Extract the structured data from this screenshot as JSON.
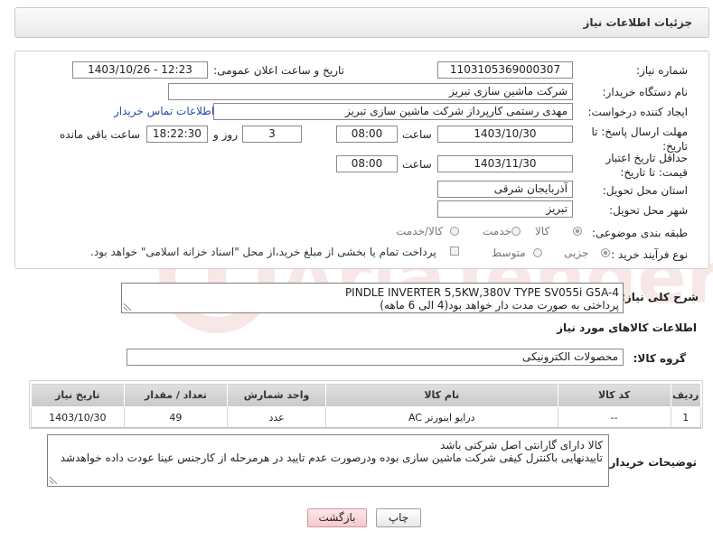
{
  "header": {
    "title": "جزئیات اطلاعات نیاز"
  },
  "form": {
    "need_number": {
      "label": "شماره نیاز:",
      "value": "1103105369000307"
    },
    "announce_datetime": {
      "label": "تاریخ و ساعت اعلان عمومی:",
      "value": "1403/10/26 - 12:23"
    },
    "buyer_org": {
      "label": "نام دستگاه خریدار:",
      "value": "شرکت ماشین سازی تبریز"
    },
    "requester": {
      "label": "ایجاد کننده درخواست:",
      "value": "مهدی رستمی کارپرداز شرکت ماشین سازی تبریز"
    },
    "buyer_contact_link": "اطلاعات تماس خریدار",
    "reply_deadline": {
      "label": "مهلت ارسال پاسخ: تا تاریخ:",
      "date": "1403/10/30",
      "time_label": "ساعت",
      "time": "08:00",
      "days": "3",
      "days_label": "روز و",
      "remaining": "18:22:30",
      "remaining_label": "ساعت باقی مانده"
    },
    "price_validity": {
      "label": "حداقل تاریخ اعتبار قیمت: تا تاریخ:",
      "date": "1403/11/30",
      "time_label": "ساعت",
      "time": "08:00"
    },
    "province": {
      "label": "استان محل تحویل:",
      "value": "آذربایجان شرقی"
    },
    "city": {
      "label": "شهر محل تحویل:",
      "value": "تبریز"
    },
    "category": {
      "label": "طبقه بندی موضوعی:",
      "options": [
        "کالا",
        "خدمت",
        "کالا/خدمت"
      ],
      "selected": "کالا"
    },
    "process_type": {
      "label": "نوع فرآیند خرید :",
      "options": [
        "جزیی",
        "متوسط"
      ],
      "selected": "جزیی",
      "note": "پرداخت تمام یا بخشی از مبلغ خرید،از محل \"اسناد خزانه اسلامی\" خواهد بود."
    }
  },
  "general_description": {
    "label": "شرح کلی نیاز:",
    "line1": "PINDLE INVERTER 5,5KW,380V TYPE SV055i G5A-4",
    "line2": "پرداختی به صورت مدت دار خواهد بود(4 الی 6 ماهه)"
  },
  "goods_info": {
    "title": "اطلاعات کالاهای مورد نیاز",
    "group_label": "گروه کالا:",
    "group_value": "محصولات الکترونیکی"
  },
  "table": {
    "headers": [
      "ردیف",
      "کد کالا",
      "نام کالا",
      "واحد شمارش",
      "تعداد / مقدار",
      "تاریخ نیاز"
    ],
    "rows": [
      [
        "1",
        "--",
        "درایو اینورتر AC",
        "عدد",
        "49",
        "1403/10/30"
      ]
    ]
  },
  "buyer_notes": {
    "label": "توضیحات خریدار:",
    "line1": "کالا دارای گارانتی اصل شرکتی باشد",
    "line2": "تاییدنهایی باکنترل کیفی شرکت ماشین سازی بوده ودرصورت عدم تایید در هرمرحله از کارجنس عینا عودت داده خواهدشد"
  },
  "buttons": {
    "print": "چاپ",
    "back": "بازگشت"
  },
  "watermark": "AriaTender.neT"
}
